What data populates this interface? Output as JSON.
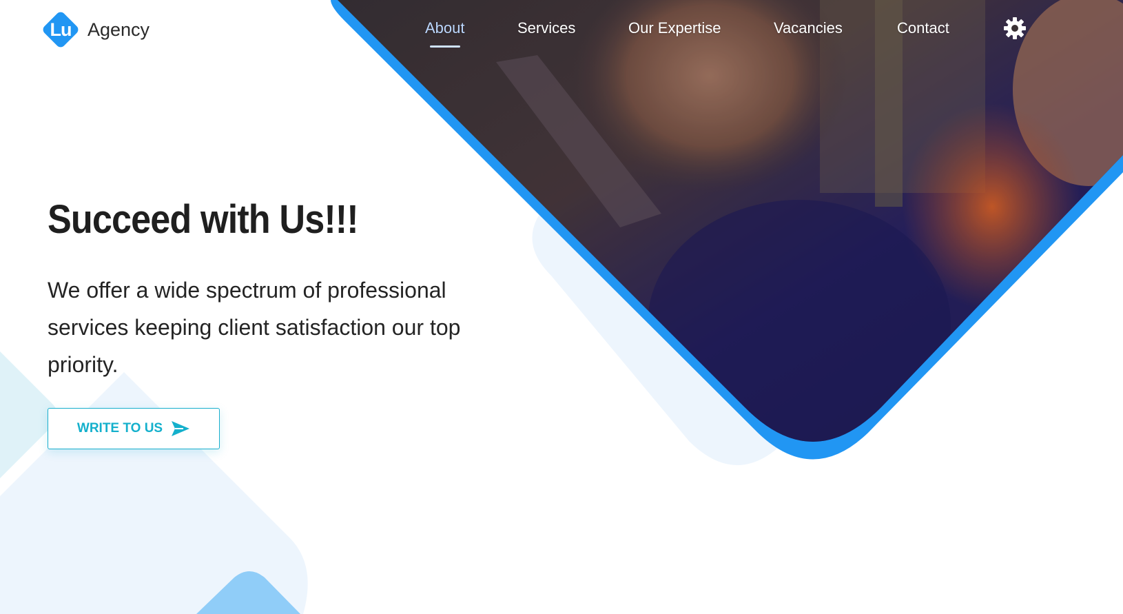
{
  "brand": {
    "logo_mark": "Lu",
    "name": "Agency"
  },
  "nav": {
    "items": [
      {
        "label": "About",
        "active": true
      },
      {
        "label": "Services",
        "active": false
      },
      {
        "label": "Our Expertise",
        "active": false
      },
      {
        "label": "Vacancies",
        "active": false
      },
      {
        "label": "Contact",
        "active": false
      }
    ],
    "settings_icon": "gear-icon"
  },
  "hero": {
    "title": "Succeed with Us!!!",
    "subtitle": "We offer a wide spectrum of professional services keeping client satisfaction our top priority.",
    "cta_label": "WRITE TO US",
    "cta_icon": "send-icon"
  },
  "colors": {
    "accent": "#2196F3",
    "cta": "#14b0cc",
    "shape_light": "#eaf4fd",
    "shape_cyan": "#dff2f8",
    "shape_blue": "#90cdf8"
  }
}
